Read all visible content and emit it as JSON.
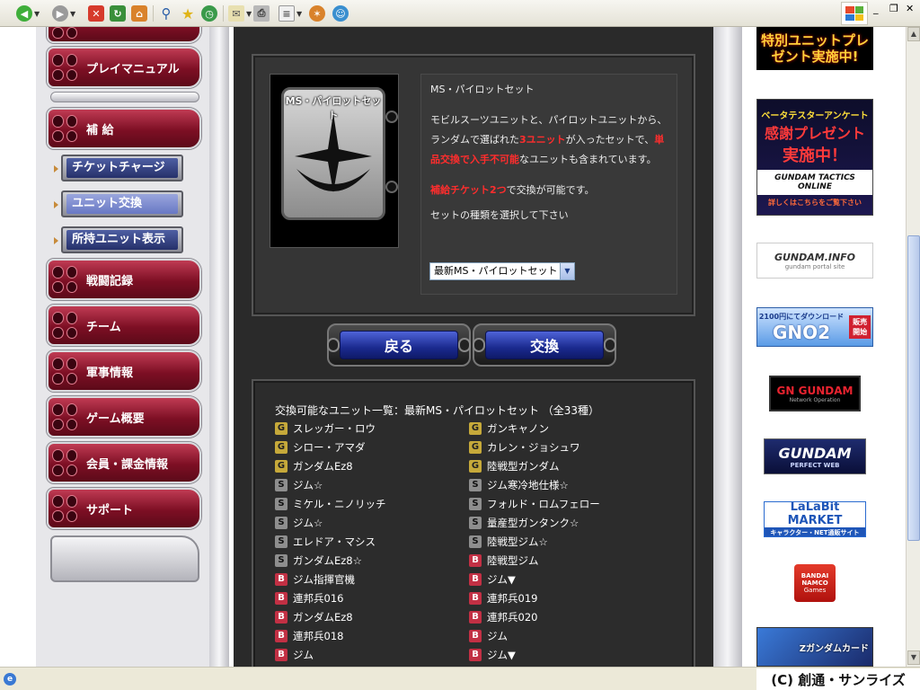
{
  "left_nav": {
    "big": [
      {
        "label": "プレイマニュアル"
      },
      {
        "label": "補 給"
      },
      {
        "label": "戦闘記録"
      },
      {
        "label": "チーム"
      },
      {
        "label": "軍事情報"
      },
      {
        "label": "ゲーム概要"
      },
      {
        "label": "会員・課金情報"
      },
      {
        "label": "サポート"
      }
    ],
    "sub": [
      {
        "label": "チケットチャージ",
        "active": false
      },
      {
        "label": "ユニット交換",
        "active": true
      },
      {
        "label": "所持ユニット表示",
        "active": false
      }
    ]
  },
  "set": {
    "card_title": "MS・パイロットセット",
    "name": "MS・パイロットセット",
    "desc_1": "モビルスーツユニットと、パイロットユニットから、ランダムで選ばれた",
    "desc_red_1": "3ユニット",
    "desc_2": "が入ったセットで、",
    "desc_red_2": "単品交換で入手不可能",
    "desc_3": "なユニットも含まれています。",
    "cost_red": "補給チケット2つ",
    "cost_text": "で交換が可能です。",
    "select_label": "セットの種類を選択して下さい",
    "select_value": "最新MS・パイロットセット"
  },
  "buttons": {
    "back": "戻る",
    "exchange": "交換"
  },
  "list": {
    "title": "交換可能なユニット一覧：最新MS・パイロットセット （全33種）",
    "left": [
      {
        "grade": "G",
        "name": "スレッガー・ロウ"
      },
      {
        "grade": "G",
        "name": "シロー・アマダ"
      },
      {
        "grade": "G",
        "name": "ガンダムEz8"
      },
      {
        "grade": "S",
        "name": "ジム☆"
      },
      {
        "grade": "S",
        "name": "ミケル・ニノリッチ"
      },
      {
        "grade": "S",
        "name": "ジム☆"
      },
      {
        "grade": "S",
        "name": "エレドア・マシス"
      },
      {
        "grade": "S",
        "name": "ガンダムEz8☆"
      },
      {
        "grade": "B",
        "name": "ジム指揮官機"
      },
      {
        "grade": "B",
        "name": "連邦兵016"
      },
      {
        "grade": "B",
        "name": "ガンダムEz8"
      },
      {
        "grade": "B",
        "name": "連邦兵018"
      },
      {
        "grade": "B",
        "name": "ジム"
      }
    ],
    "right": [
      {
        "grade": "G",
        "name": "ガンキャノン"
      },
      {
        "grade": "G",
        "name": "カレン・ジョシュワ"
      },
      {
        "grade": "G",
        "name": "陸戦型ガンダム"
      },
      {
        "grade": "S",
        "name": "ジム寒冷地仕様☆"
      },
      {
        "grade": "S",
        "name": "フォルド・ロムフェロー"
      },
      {
        "grade": "S",
        "name": "量産型ガンタンク☆"
      },
      {
        "grade": "S",
        "name": "陸戦型ジム☆"
      },
      {
        "grade": "B",
        "name": "陸戦型ジム"
      },
      {
        "grade": "B",
        "name": "ジム▼"
      },
      {
        "grade": "B",
        "name": "連邦兵019"
      },
      {
        "grade": "B",
        "name": "連邦兵020"
      },
      {
        "grade": "B",
        "name": "ジム"
      },
      {
        "grade": "B",
        "name": "ジム▼"
      }
    ]
  },
  "banners": {
    "special": "特別ユニットプレゼント実施中!",
    "beta_1": "ベータテスターアンケート",
    "beta_2": "感謝プレゼント",
    "beta_3": "実施中！",
    "beta_logo": "GUNDAM TACTICS ONLINE",
    "beta_more": "詳しくはこちらをご覧下さい",
    "gundam_info": "GUNDAM.INFO",
    "gundam_info_sub": "gundam portal site",
    "gno2_top": "2100円にてダウンロード",
    "gno2": "GNO2",
    "gno2_side": "販売開始",
    "gno": "GN GUNDAM",
    "gno_sub": "Network Operation",
    "perfect": "GUNDAM",
    "perfect_sub": "PERFECT WEB",
    "lalabit": "LaLaBit MARKET",
    "lalabit_sub": "キャラクター・NET通販サイト",
    "bandai_1": "BANDAI",
    "bandai_2": "NAMCO",
    "bandai_3": "Games",
    "card": "Zガンダムカード"
  },
  "copyright": "(C) 創通・サンライズ",
  "colors": {
    "accent_red": "#ff2d2d",
    "nav_red": "#7d0f24",
    "button_blue": "#1b2a8f"
  }
}
